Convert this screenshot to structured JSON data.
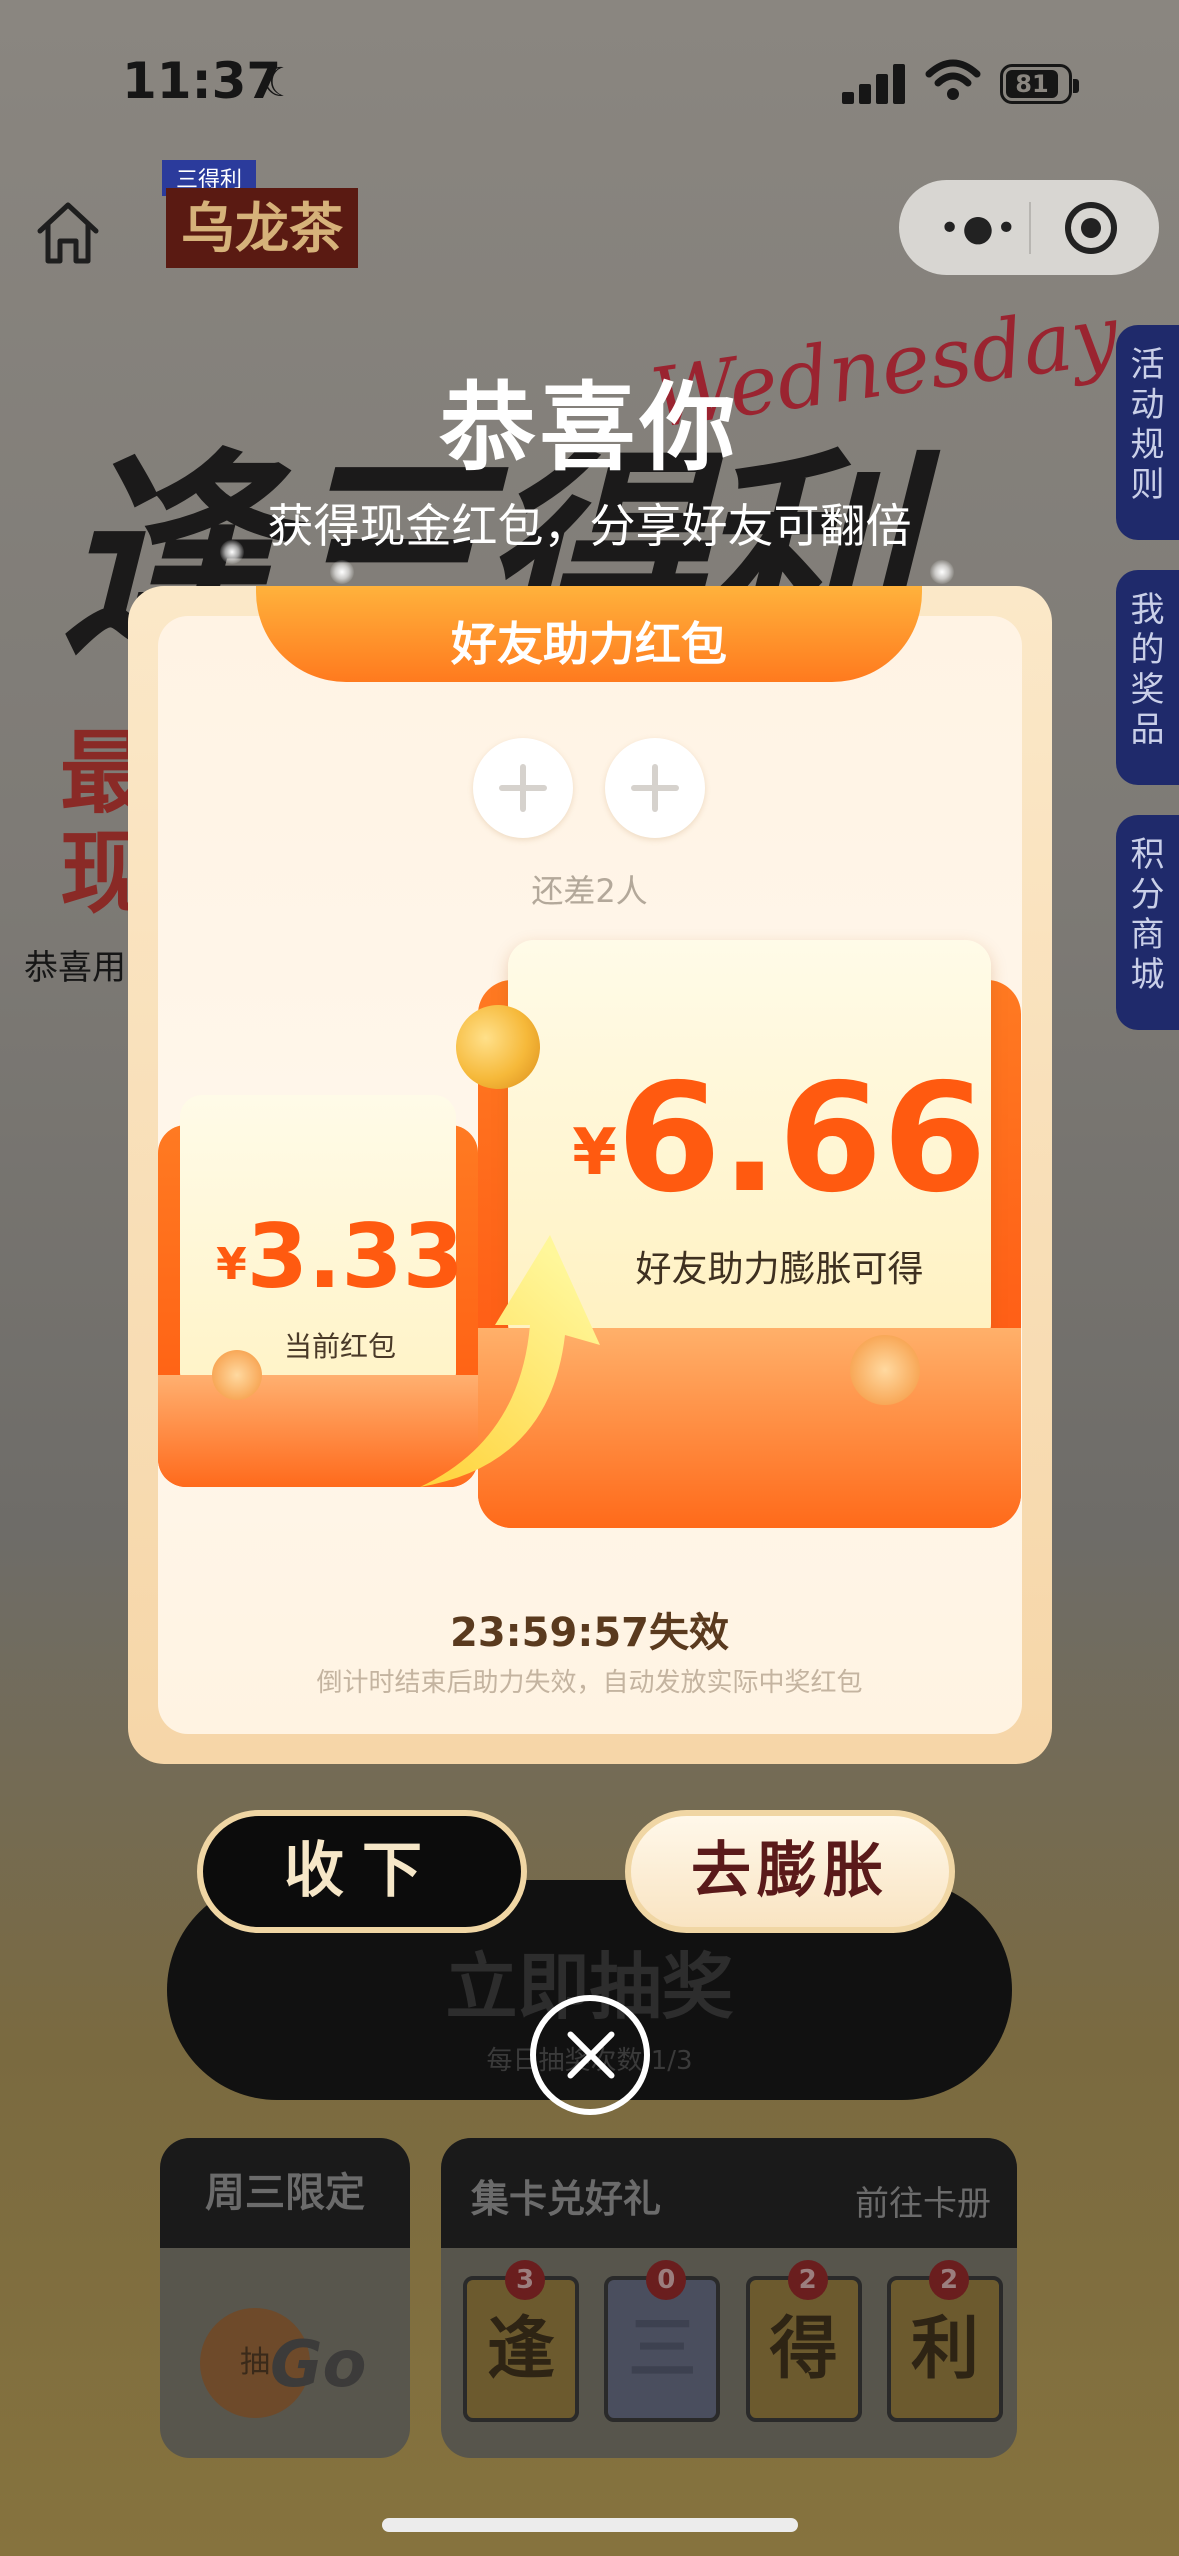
{
  "status_bar": {
    "time": "11:37",
    "battery": "81"
  },
  "header": {
    "brand_top": "三得利",
    "brand_main": "乌龙茶"
  },
  "background": {
    "hero_text": "逢三得利",
    "hero_script": "Wednesday",
    "red_line_1": "最",
    "red_line_2": "现",
    "congrats_line": "恭喜用",
    "side_tabs": [
      "活动规则",
      "我的奖品",
      "积分商城"
    ],
    "draw_button": "立即抽奖",
    "draw_sub": "每日抽奖次数 1/3",
    "wednesday_card": {
      "title": "周三限定",
      "badge": "抽",
      "go": "Go"
    },
    "collect_card": {
      "title": "集卡兑好礼",
      "link": "前往卡册",
      "tiles": [
        {
          "char": "逢",
          "count": "3"
        },
        {
          "char": "三",
          "count": "0"
        },
        {
          "char": "得",
          "count": "2"
        },
        {
          "char": "利",
          "count": "2"
        }
      ]
    }
  },
  "modal": {
    "title": "恭喜你",
    "subtitle": "获得现金红包，分享好友可翻倍",
    "ribbon": "好友助力红包",
    "remaining": "还差2人",
    "current": {
      "currency": "¥",
      "amount": "3.33",
      "label": "当前红包"
    },
    "boosted": {
      "currency": "¥",
      "amount": "6.66",
      "label": "好友助力膨胀可得"
    },
    "countdown": "23:59:57失效",
    "countdown_note": "倒计时结束后助力失效，自动发放实际中奖红包",
    "accept_button": "收下",
    "inflate_button": "去膨胀"
  },
  "colors": {
    "accent_orange": "#ff5a10",
    "ribbon_orange": "#ff7a1e",
    "panel_cream": "#fff3e4",
    "dark_button": "#0c0c0c",
    "side_tab_blue": "#1f2a6b"
  },
  "icons": [
    "home-icon",
    "more-dots-icon",
    "target-icon",
    "plus-icon",
    "close-icon",
    "coin-icon",
    "arrow-up-icon"
  ]
}
